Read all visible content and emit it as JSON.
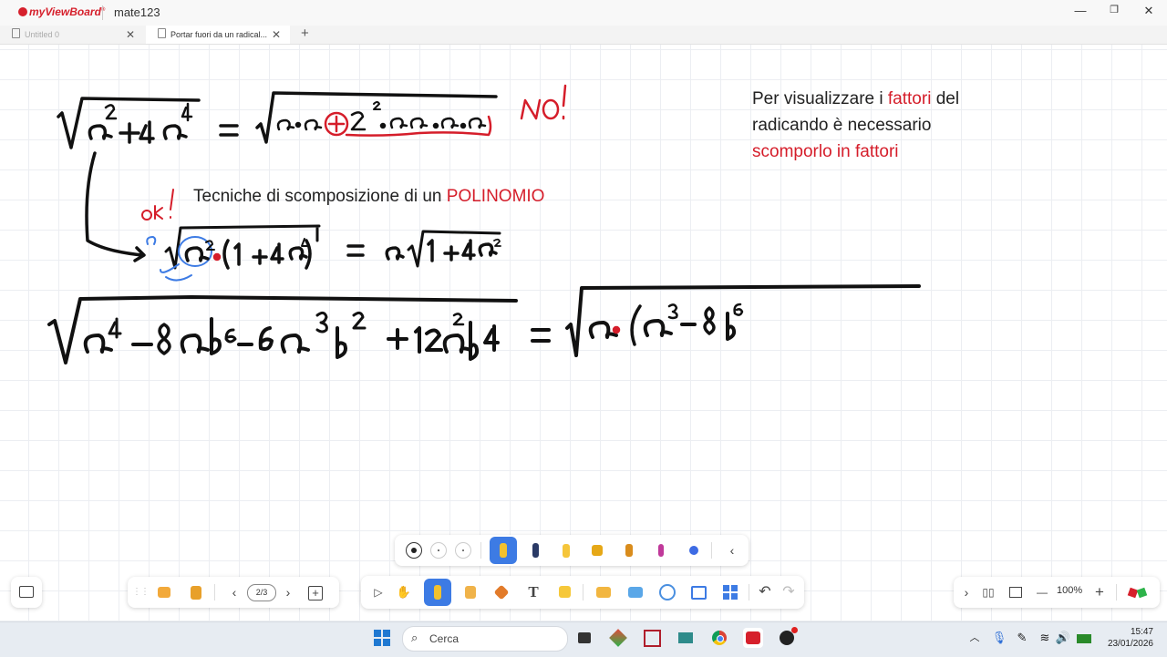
{
  "app": {
    "brand": "myViewBoard",
    "trademark": "®",
    "title": "mate123"
  },
  "window_controls": {
    "minimize": "—",
    "restore": "❐",
    "close": "✕"
  },
  "tabs": [
    {
      "label": "Untitled 0",
      "close": "✕"
    },
    {
      "label": "Portar fuori da un radical...",
      "close": "✕"
    }
  ],
  "add_tab": "+",
  "note": {
    "line1_prefix": "Per visualizzare i ",
    "line1_red": "fattori",
    "line1_suffix": " del",
    "line2": "radicando è necessario",
    "line3_red": "scomporlo in fattori"
  },
  "subtitle": {
    "prefix": "Tecniche di scomposizione di un ",
    "red": "POLINOMIO"
  },
  "handwriting": {
    "no": "NO!",
    "ok": "ok!"
  },
  "pen_panel": {
    "collapse": "‹"
  },
  "left_bar": {
    "page_indicator": "2/3",
    "prev": "‹",
    "next": "›",
    "add_page": "+"
  },
  "main_toolbar": {
    "undo": "↶",
    "redo": "↷"
  },
  "zoom_bar": {
    "expand": "›",
    "minus": "—",
    "zoom": "100%",
    "plus": "+"
  },
  "taskbar": {
    "search_placeholder": "Cerca",
    "time": "15:47",
    "date": "23/01/2026",
    "tray_up": "︿"
  },
  "colors": {
    "accent_blue": "#3d7be4",
    "ink": "#111111",
    "red": "#d51d2a",
    "brand_red": "#d6202c"
  }
}
